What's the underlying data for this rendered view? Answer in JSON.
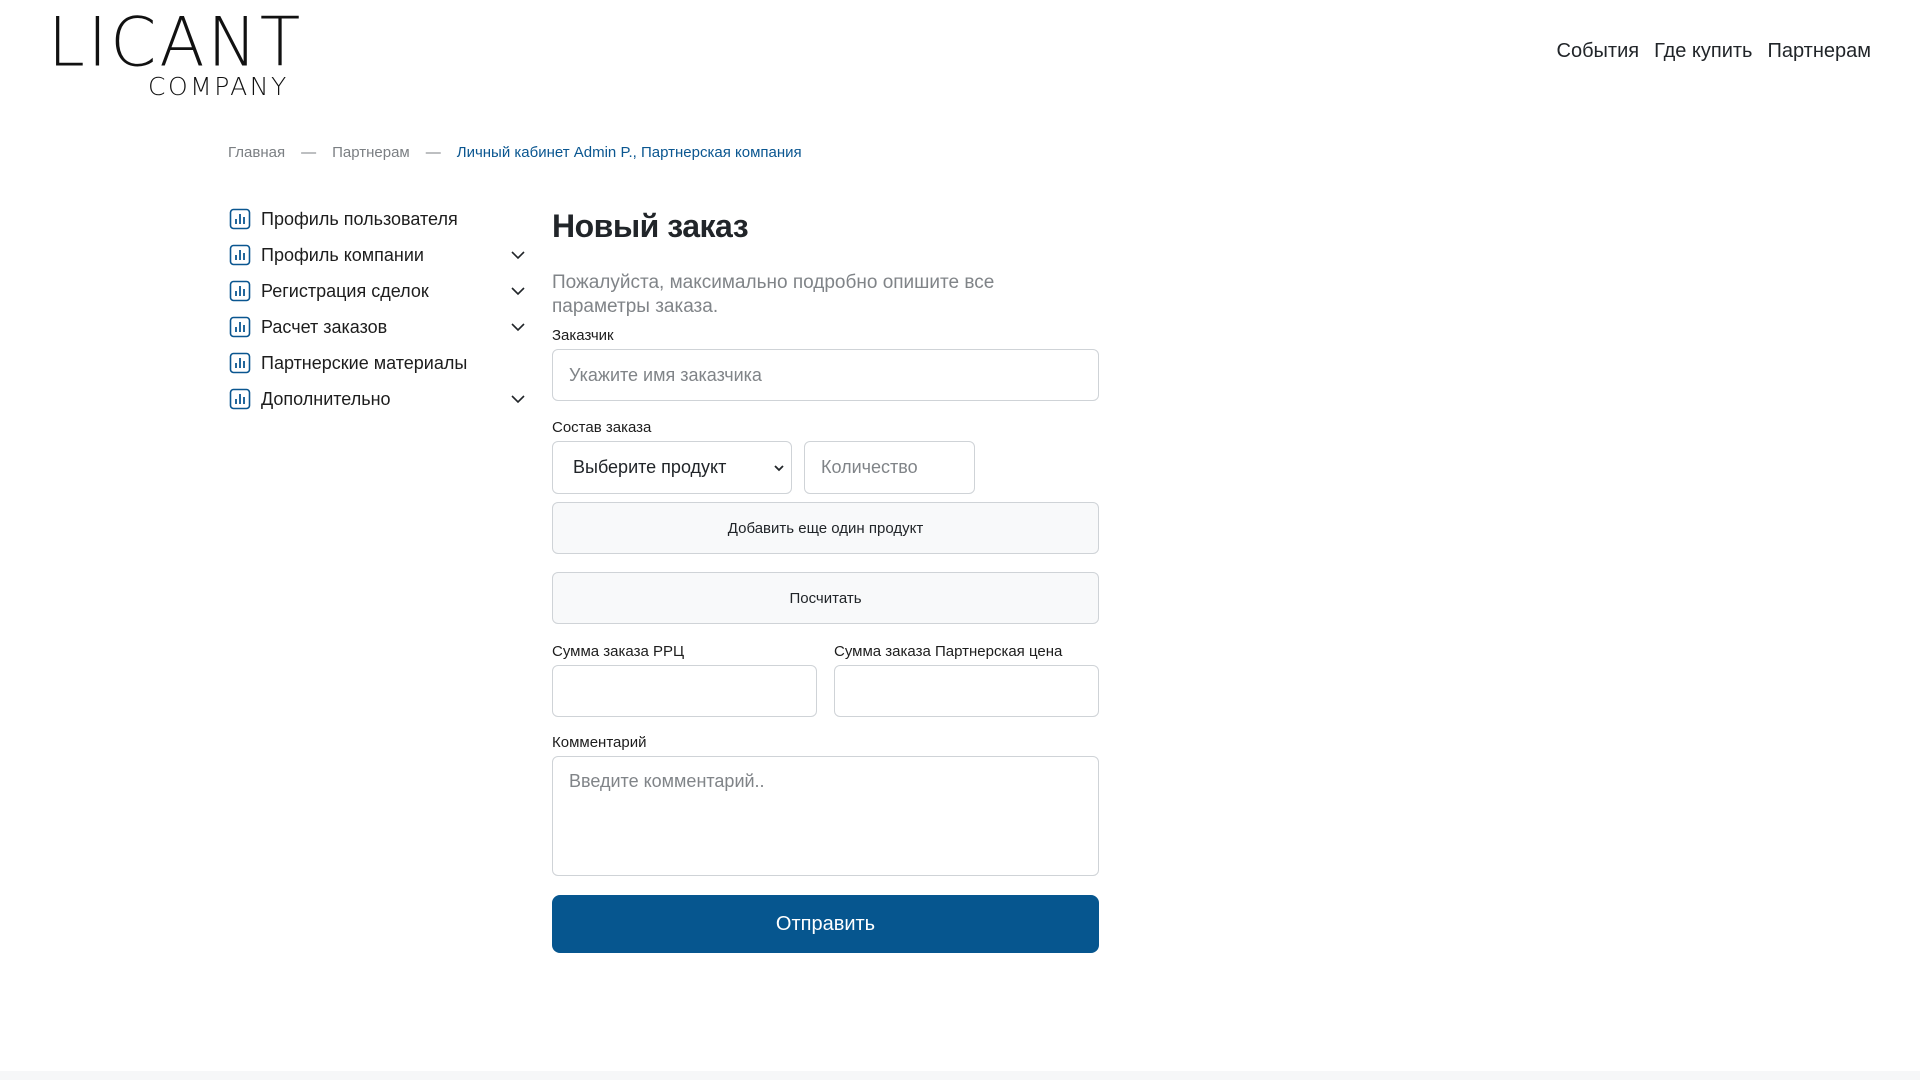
{
  "header": {
    "logo_main": "LICANT",
    "logo_sub": "COMPANY",
    "nav": [
      "События",
      "Где купить",
      "Партнерам"
    ]
  },
  "breadcrumb": {
    "items": [
      "Главная",
      "Партнерам"
    ],
    "separator": "—",
    "current": "Личный кабинет Admin P., Партнерская компания"
  },
  "sidebar": {
    "items": [
      {
        "label": "Профиль пользователя",
        "icon": "chart-icon",
        "expandable": false
      },
      {
        "label": "Профиль компании",
        "icon": "chart-icon",
        "expandable": true
      },
      {
        "label": "Регистрация сделок",
        "icon": "chart-icon",
        "expandable": true
      },
      {
        "label": "Расчет заказов",
        "icon": "chart-icon",
        "expandable": true
      },
      {
        "label": "Партнерские материалы",
        "icon": "chart-icon",
        "expandable": false
      },
      {
        "label": "Дополнительно",
        "icon": "chart-icon",
        "expandable": true
      }
    ]
  },
  "main": {
    "title": "Новый заказ",
    "subtitle": "Пожалуйста, максимально подробно опишите все параметры заказа.",
    "customer": {
      "label": "Заказчик",
      "placeholder": "Укажите имя заказчика",
      "value": ""
    },
    "order": {
      "label": "Состав заказа",
      "product_select": "Выберите продукт",
      "quantity_placeholder": "Количество",
      "add_button": "Добавить еще один продукт"
    },
    "calculate_button": "Посчитать",
    "sum_rrc": {
      "label": "Сумма заказа РРЦ",
      "value": ""
    },
    "sum_partner": {
      "label": "Сумма заказа Партнерская цена",
      "value": ""
    },
    "comment": {
      "label": "Комментарий",
      "placeholder": "Введите комментарий.."
    },
    "submit_button": "Отправить"
  },
  "colors": {
    "accent": "#06568f",
    "breadcrumb_current": "#0a5690",
    "muted_text": "#808488",
    "border": "#cfd3d7"
  }
}
